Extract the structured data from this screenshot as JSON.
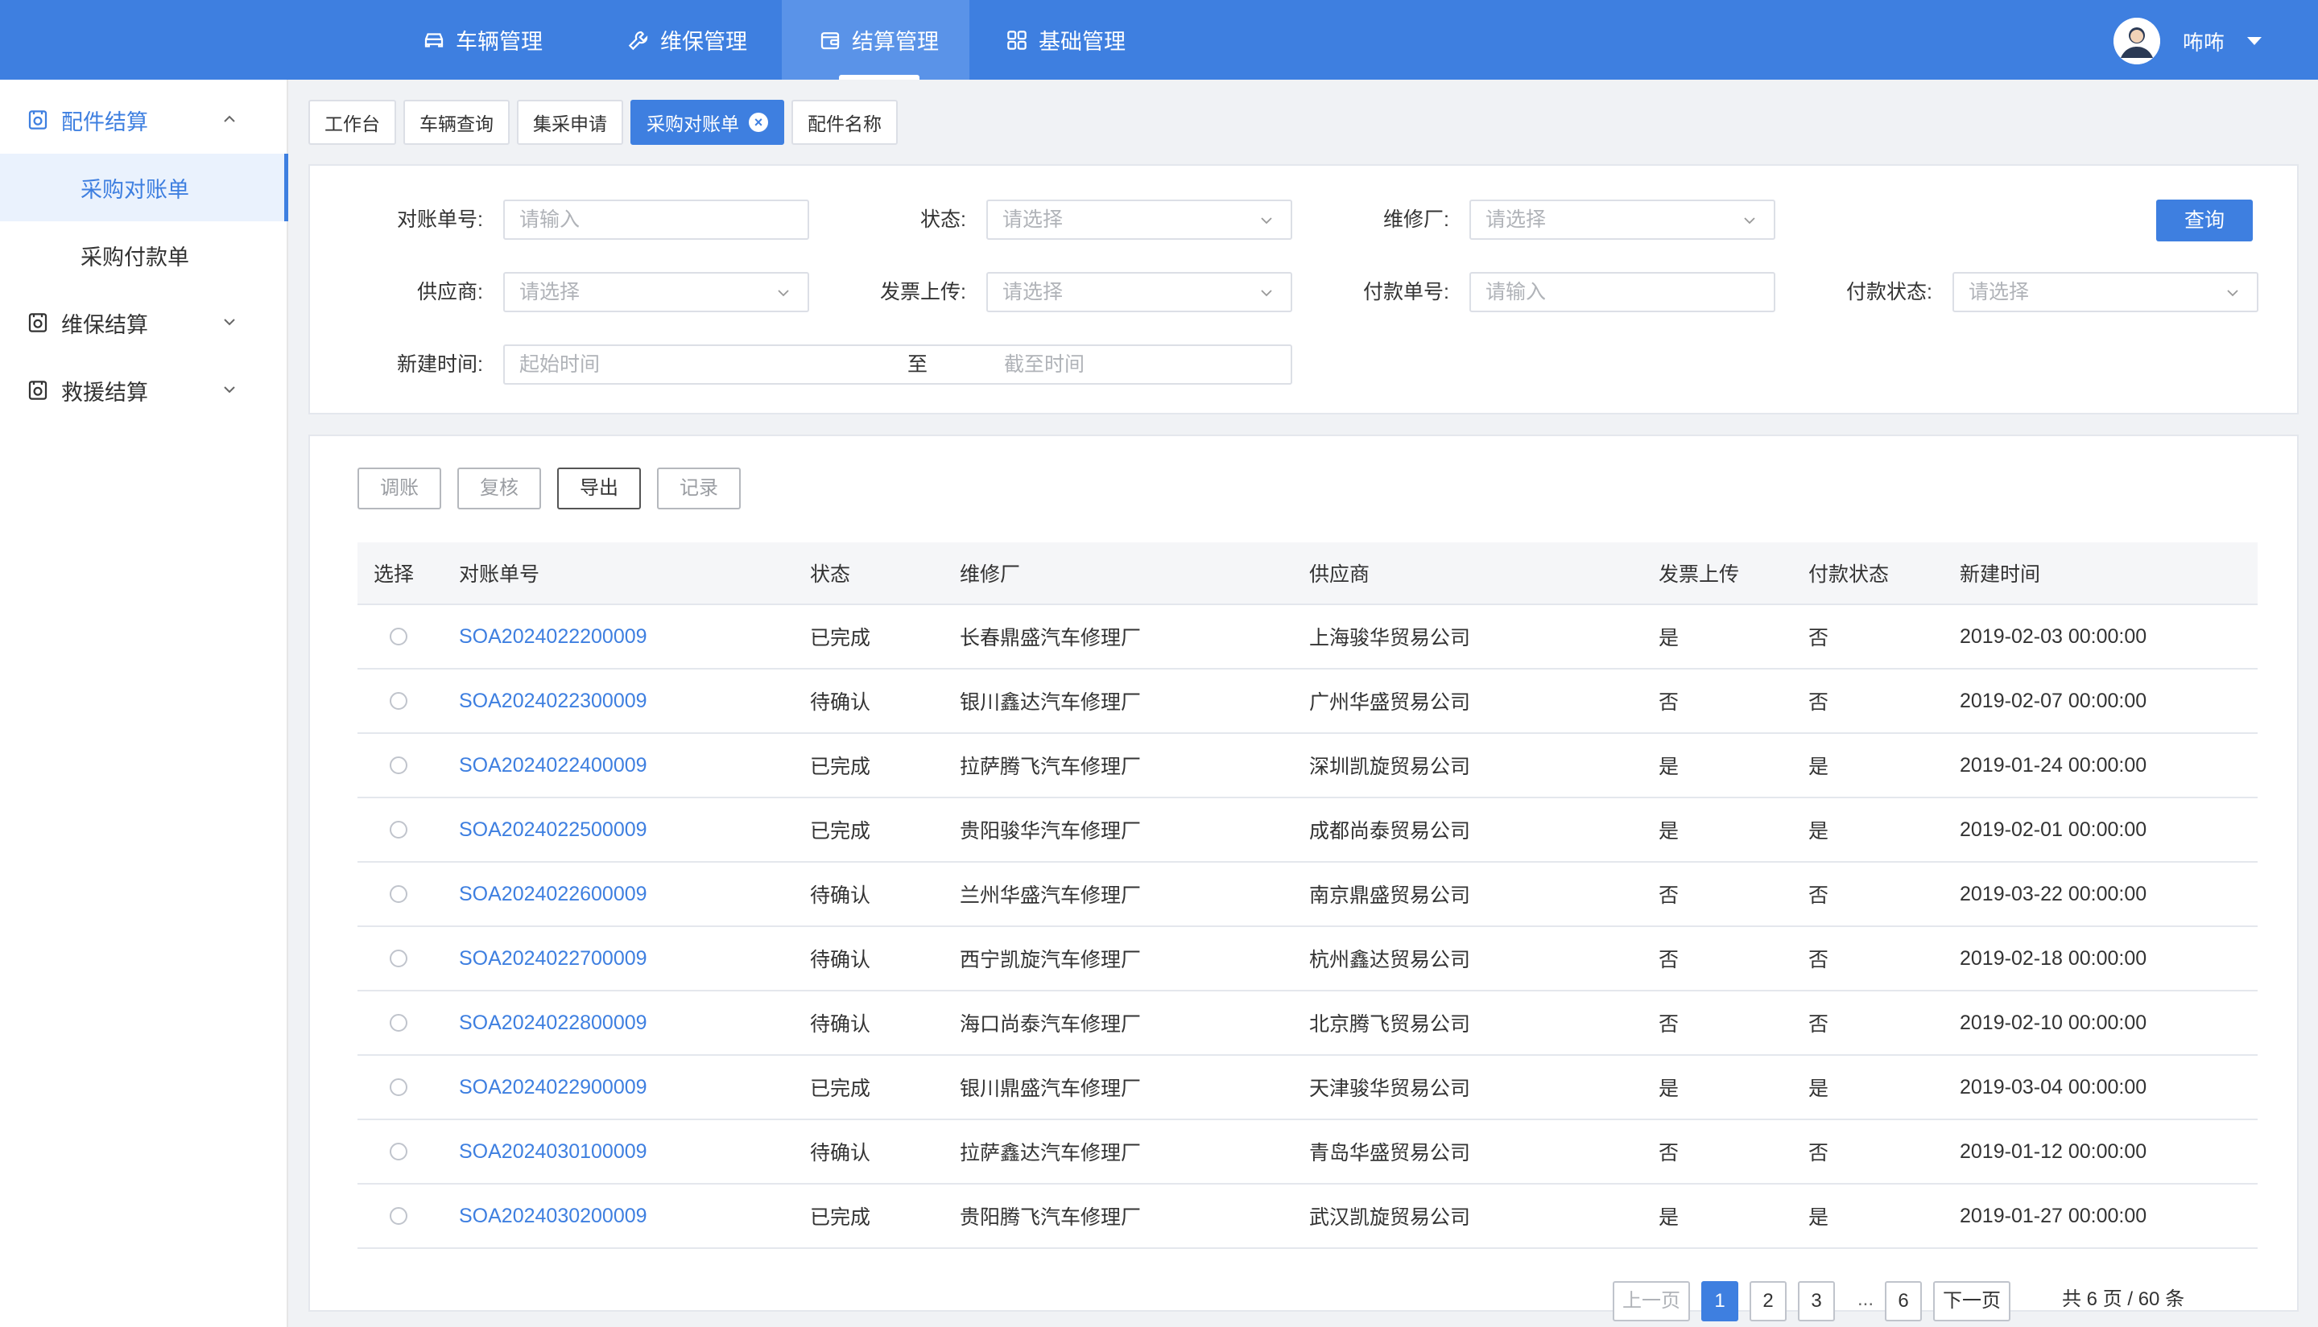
{
  "nav": {
    "items": [
      {
        "label": "车辆管理",
        "icon": "car-icon"
      },
      {
        "label": "维保管理",
        "icon": "wrench-icon"
      },
      {
        "label": "结算管理",
        "icon": "wallet-icon",
        "active": true
      },
      {
        "label": "基础管理",
        "icon": "grid-icon"
      }
    ],
    "user": {
      "name": "咘咘"
    }
  },
  "sidebar": {
    "groups": [
      {
        "label": "配件结算",
        "icon": "settlement-icon",
        "open": true,
        "children": [
          {
            "label": "采购对账单",
            "active": true
          },
          {
            "label": "采购付款单"
          }
        ]
      },
      {
        "label": "维保结算",
        "icon": "settlement-icon"
      },
      {
        "label": "救援结算",
        "icon": "settlement-icon"
      }
    ]
  },
  "tabs": [
    {
      "label": "工作台"
    },
    {
      "label": "车辆查询"
    },
    {
      "label": "集采申请"
    },
    {
      "label": "采购对账单",
      "active": true
    },
    {
      "label": "配件名称"
    }
  ],
  "filter": {
    "statement_no": {
      "label": "对账单号:",
      "placeholder": "请输入"
    },
    "status": {
      "label": "状态:",
      "placeholder": "请选择"
    },
    "repair_shop": {
      "label": "维修厂:",
      "placeholder": "请选择"
    },
    "supplier": {
      "label": "供应商:",
      "placeholder": "请选择"
    },
    "invoice_upload": {
      "label": "发票上传:",
      "placeholder": "请选择"
    },
    "payment_no": {
      "label": "付款单号:",
      "placeholder": "请输入"
    },
    "payment_status": {
      "label": "付款状态:",
      "placeholder": "请选择"
    },
    "created_time": {
      "label": "新建时间:",
      "start_placeholder": "起始时间",
      "separator": "至",
      "end_placeholder": "截至时间"
    },
    "query_label": "查询"
  },
  "actions": {
    "adjust": "调账",
    "review": "复核",
    "export": "导出",
    "record": "记录"
  },
  "table": {
    "headers": {
      "select": "选择",
      "statement_no": "对账单号",
      "status": "状态",
      "repair_shop": "维修厂",
      "supplier": "供应商",
      "invoice": "发票上传",
      "payment": "付款状态",
      "created": "新建时间"
    },
    "rows": [
      {
        "no": "SOA2024022200009",
        "status": "已完成",
        "shop": "长春鼎盛汽车修理厂",
        "supplier": "上海骏华贸易公司",
        "invoice": "是",
        "payment": "否",
        "created": "2019-02-03 00:00:00"
      },
      {
        "no": "SOA2024022300009",
        "status": "待确认",
        "shop": "银川鑫达汽车修理厂",
        "supplier": "广州华盛贸易公司",
        "invoice": "否",
        "payment": "否",
        "created": "2019-02-07 00:00:00"
      },
      {
        "no": "SOA2024022400009",
        "status": "已完成",
        "shop": "拉萨腾飞汽车修理厂",
        "supplier": "深圳凯旋贸易公司",
        "invoice": "是",
        "payment": "是",
        "created": "2019-01-24 00:00:00"
      },
      {
        "no": "SOA2024022500009",
        "status": "已完成",
        "shop": "贵阳骏华汽车修理厂",
        "supplier": "成都尚泰贸易公司",
        "invoice": "是",
        "payment": "是",
        "created": "2019-02-01 00:00:00"
      },
      {
        "no": "SOA2024022600009",
        "status": "待确认",
        "shop": "兰州华盛汽车修理厂",
        "supplier": "南京鼎盛贸易公司",
        "invoice": "否",
        "payment": "否",
        "created": "2019-03-22 00:00:00"
      },
      {
        "no": "SOA2024022700009",
        "status": "待确认",
        "shop": "西宁凯旋汽车修理厂",
        "supplier": "杭州鑫达贸易公司",
        "invoice": "否",
        "payment": "否",
        "created": "2019-02-18 00:00:00"
      },
      {
        "no": "SOA2024022800009",
        "status": "待确认",
        "shop": "海口尚泰汽车修理厂",
        "supplier": "北京腾飞贸易公司",
        "invoice": "否",
        "payment": "否",
        "created": "2019-02-10 00:00:00"
      },
      {
        "no": "SOA2024022900009",
        "status": "已完成",
        "shop": "银川鼎盛汽车修理厂",
        "supplier": "天津骏华贸易公司",
        "invoice": "是",
        "payment": "是",
        "created": "2019-03-04 00:00:00"
      },
      {
        "no": "SOA2024030100009",
        "status": "待确认",
        "shop": "拉萨鑫达汽车修理厂",
        "supplier": "青岛华盛贸易公司",
        "invoice": "否",
        "payment": "否",
        "created": "2019-01-12 00:00:00"
      },
      {
        "no": "SOA2024030200009",
        "status": "已完成",
        "shop": "贵阳腾飞汽车修理厂",
        "supplier": "武汉凯旋贸易公司",
        "invoice": "是",
        "payment": "是",
        "created": "2019-01-27 00:00:00"
      }
    ]
  },
  "pagination": {
    "prev": "上一页",
    "pages": [
      "1",
      "2",
      "3"
    ],
    "ellipsis": "...",
    "last": "6",
    "next": "下一页",
    "current": 1,
    "total": "共 6 页 / 60 条"
  },
  "colors": {
    "primary": "#3e7fe0"
  }
}
